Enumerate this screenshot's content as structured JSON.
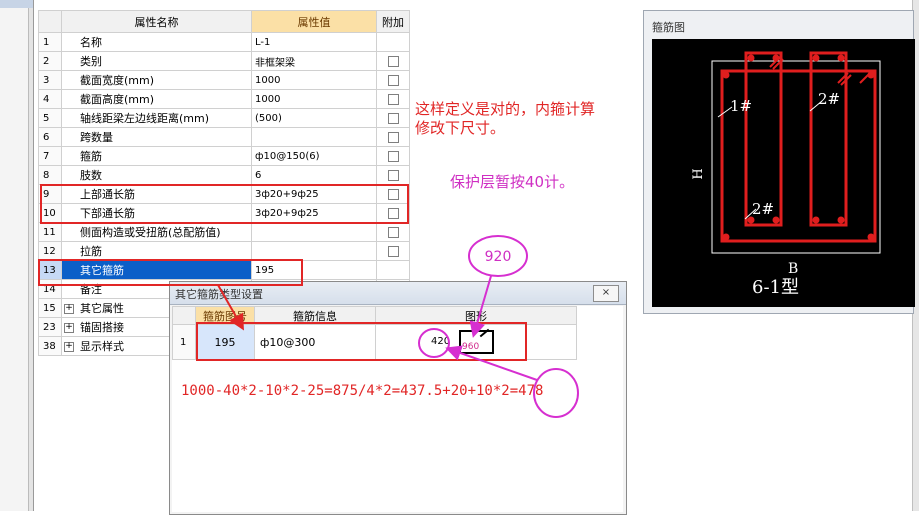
{
  "property_grid": {
    "headers": {
      "name": "属性名称",
      "value": "属性值",
      "attach": "附加"
    },
    "rows": [
      {
        "num": "1",
        "name": "名称",
        "value": "L-1",
        "checkbox": false
      },
      {
        "num": "2",
        "name": "类别",
        "value": "非框架梁",
        "checkbox": true
      },
      {
        "num": "3",
        "name": "截面宽度(mm)",
        "value": "1000",
        "checkbox": true
      },
      {
        "num": "4",
        "name": "截面高度(mm)",
        "value": "1000",
        "checkbox": true
      },
      {
        "num": "5",
        "name": "轴线距梁左边线距离(mm)",
        "value": "(500)",
        "checkbox": true
      },
      {
        "num": "6",
        "name": "跨数量",
        "value": "",
        "checkbox": true
      },
      {
        "num": "7",
        "name": "箍筋",
        "value": "ф10@150(6)",
        "checkbox": true
      },
      {
        "num": "8",
        "name": "肢数",
        "value": "6",
        "checkbox": true
      },
      {
        "num": "9",
        "name": "上部通长筋",
        "value": "3ф20+9ф25",
        "checkbox": true
      },
      {
        "num": "10",
        "name": "下部通长筋",
        "value": "3ф20+9ф25",
        "checkbox": true
      },
      {
        "num": "11",
        "name": "侧面构造或受扭筋(总配筋值)",
        "value": "",
        "checkbox": true
      },
      {
        "num": "12",
        "name": "拉筋",
        "value": "",
        "checkbox": true
      },
      {
        "num": "13",
        "name": "其它箍筋",
        "value": "195",
        "checkbox": false
      },
      {
        "num": "14",
        "name": "备注",
        "value": "",
        "checkbox": false
      },
      {
        "num": "15",
        "name": "其它属性",
        "value": "",
        "expander": "+"
      },
      {
        "num": "23",
        "name": "锚固搭接",
        "value": "",
        "expander": "+"
      },
      {
        "num": "38",
        "name": "显示样式",
        "value": "",
        "expander": "+"
      }
    ]
  },
  "annotations": {
    "note_line1": "这样定义是对的，内箍计算",
    "note_line2": "修改下尺寸。",
    "cover_note": "保护层暂按40计。",
    "bubble_top": "920",
    "formula": "1000-40*2-10*2-25=875/4*2=437.5+20+10*2=478"
  },
  "preview": {
    "title": "箍筋图",
    "label_1": "1#",
    "label_2a": "2#",
    "label_2b": "2#",
    "label_h": "H",
    "label_b": "B",
    "type_label": "6-1型"
  },
  "dialog": {
    "title": "其它箍筋类型设置",
    "close": "×",
    "headers": {
      "id": "箍筋图号",
      "info": "箍筋信息",
      "shape": "图形"
    },
    "row": {
      "num": "1",
      "id": "195",
      "info": "ф10@300",
      "dim1": "420",
      "dim2": "960"
    }
  },
  "colors": {
    "highlight_red": "#e12626",
    "annotation_magenta": "#d62fd0",
    "selected_blue": "#0b5fc8",
    "header_orange": "#fbe0a6"
  }
}
